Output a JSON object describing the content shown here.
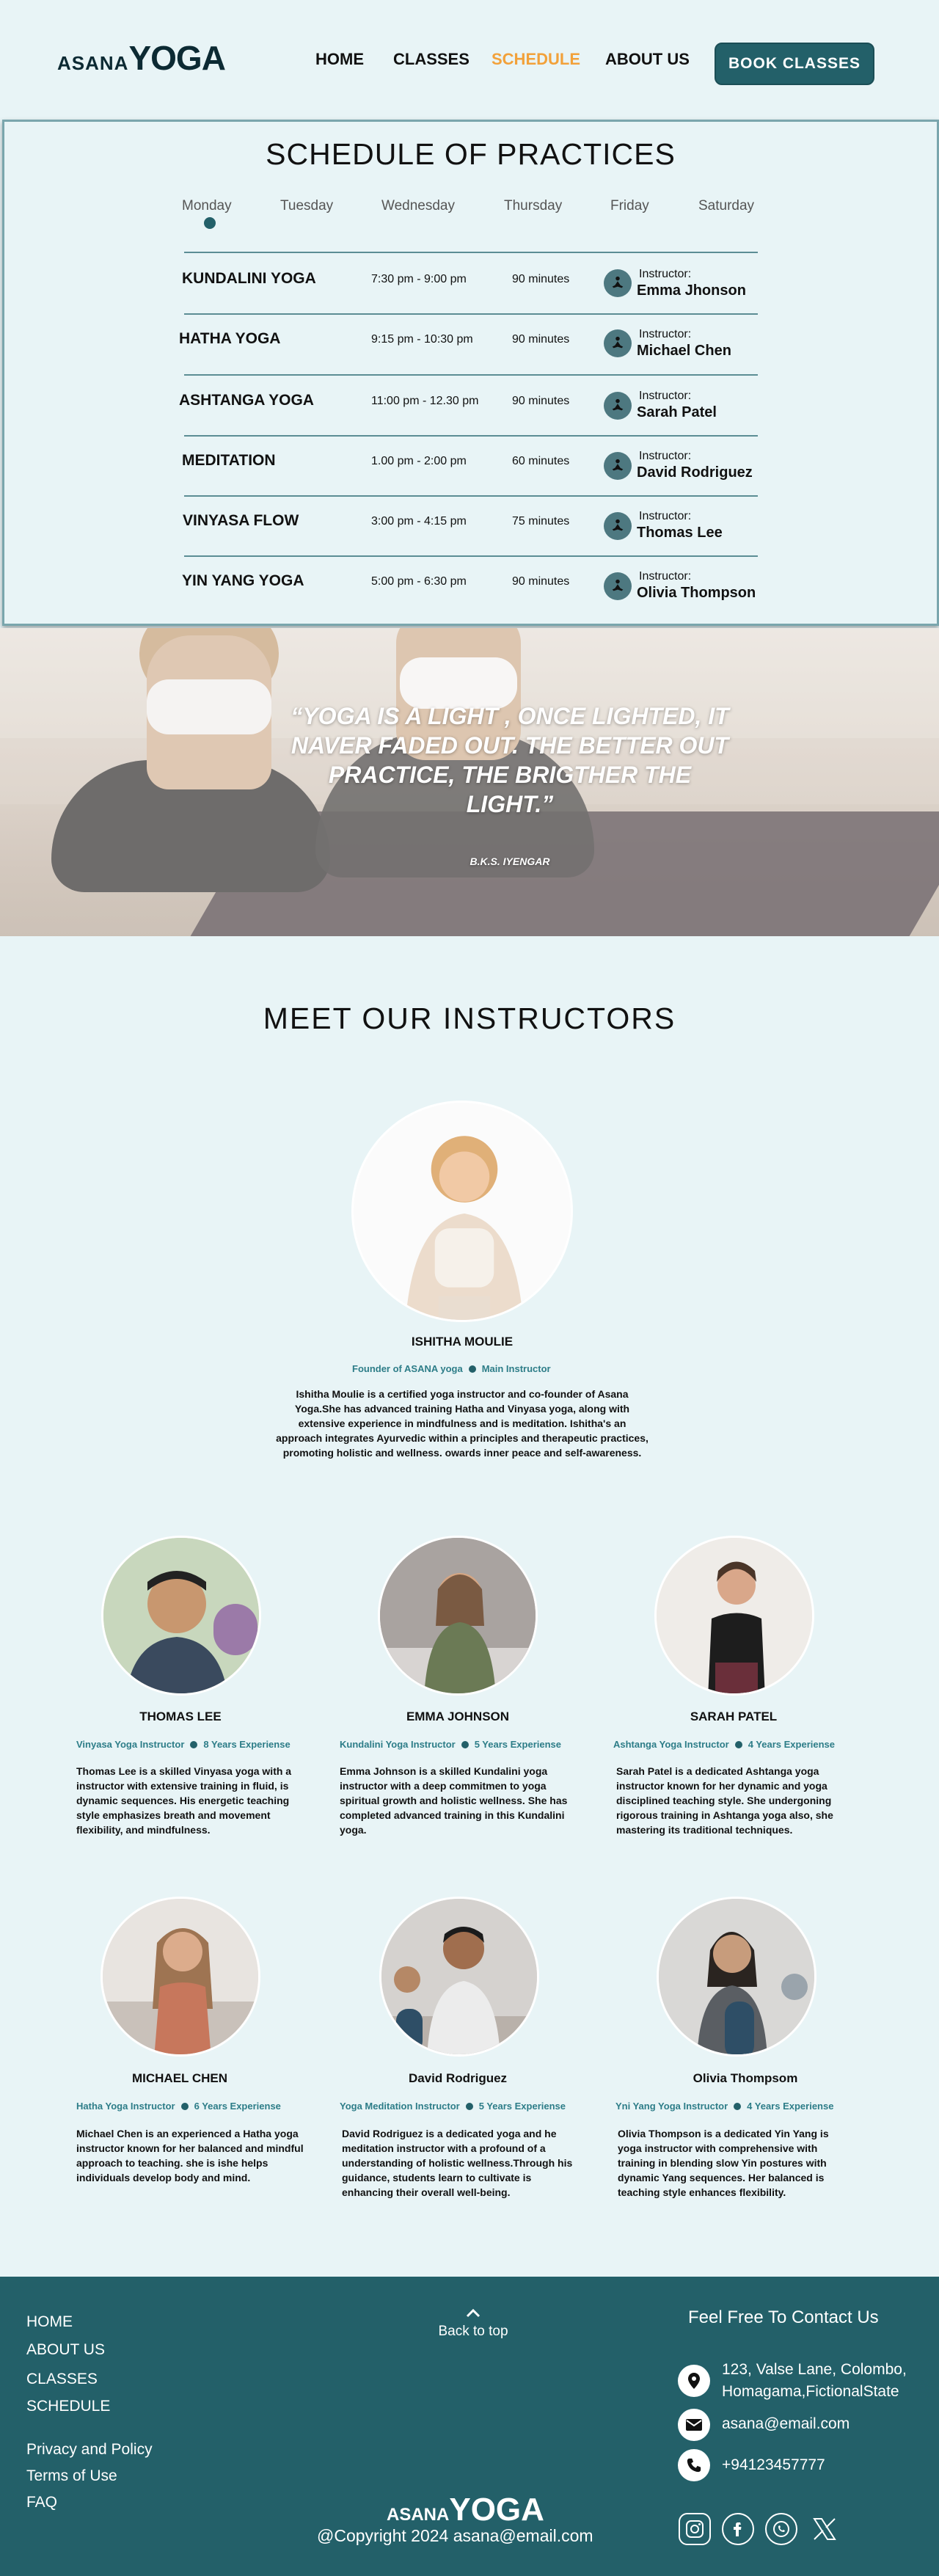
{
  "header": {
    "logo_small": "ASANA",
    "logo_big": "YOGA",
    "nav": [
      {
        "label": "HOME"
      },
      {
        "label": "CLASSES"
      },
      {
        "label": "SCHEDULE"
      },
      {
        "label": "ABOUT US"
      }
    ],
    "active_nav": "SCHEDULE",
    "book_label": "BOOK  CLASSES",
    "accent_color": "#f2a13a",
    "brand_color": "#236069"
  },
  "schedule": {
    "title": "SCHEDULE OF PRACTICES",
    "days": [
      "Monday",
      "Tuesday",
      "Wednesday",
      "Thursday",
      "Friday",
      "Saturday"
    ],
    "selected_day": "Monday",
    "instructor_label": "Instructor:",
    "rows": [
      {
        "name": "KUNDALINI YOGA",
        "time": "7:30 pm - 9:00 pm",
        "duration": "90 minutes",
        "instructor": "Emma Jhonson"
      },
      {
        "name": "HATHA YOGA",
        "time": "9:15 pm - 10:30 pm",
        "duration": "90 minutes",
        "instructor": "Michael  Chen"
      },
      {
        "name": "ASHTANGA YOGA",
        "time": "11:00 pm - 12.30 pm",
        "duration": "90 minutes",
        "instructor": "Sarah  Patel"
      },
      {
        "name": "MEDITATION",
        "time": "1.00 pm - 2:00 pm",
        "duration": "60 minutes",
        "instructor": "David Rodriguez"
      },
      {
        "name": "VINYASA FLOW",
        "time": "3:00 pm - 4:15 pm",
        "duration": "75 minutes",
        "instructor": "Thomas Lee"
      },
      {
        "name": "YIN YANG YOGA",
        "time": "5:00 pm - 6:30 pm",
        "duration": "90 minutes",
        "instructor": "Olivia Thompson"
      }
    ]
  },
  "hero": {
    "quote": "“YOGA IS A LIGHT , ONCE LIGHTED, IT NAVER FADED OUT. THE BETTER OUT PRACTICE,  THE BRIGTHER THE LIGHT.”",
    "author": "B.K.S. IYENGAR"
  },
  "instructors": {
    "title": "MEET OUR INSTRUCTORS",
    "founder": {
      "name": "ISHITHA MOULIE",
      "role": "Founder of ASANA yoga",
      "role2": "Main Instructor",
      "bio": "Ishitha Moulie is a certified yoga instructor and co-founder of Asana Yoga.She has advanced training  Hatha and Vinyasa yoga, along with extensive experience in mindfulness and is meditation. Ishitha's an approach integrates Ayurvedic within a principles and therapeutic practices, promoting holistic and wellness. owards inner peace and self-awareness."
    },
    "list": [
      {
        "name": "THOMAS LEE",
        "role": "Vinyasa Yoga Instructor",
        "exp": "8 Years Experiense",
        "bio": "Thomas Lee is a skilled Vinyasa yoga with a instructor with extensive training in fluid,  is dynamic sequences. His energetic teaching style emphasizes breath and movement flexibility, and mindfulness."
      },
      {
        "name": "EMMA JOHNSON",
        "role": "Kundalini Yoga Instructor",
        "exp": "5 Years Experiense",
        "bio": "Emma Johnson is a skilled Kundalini yoga instructor with a deep commitmen to yoga spiritual growth and holistic wellness. She has completed advanced training in this Kundalini yoga."
      },
      {
        "name": "SARAH PATEL",
        "role": "Ashtanga Yoga Instructor",
        "exp": "4 Years Experiense",
        "bio": "Sarah Patel is a  dedicated Ashtanga yoga instructor known for her dynamic and  yoga disciplined teaching style. She undergoning rigorous training in Ashtanga yoga also, she mastering its traditional  techniques."
      },
      {
        "name": "MICHAEL CHEN",
        "role": "Hatha  Yoga Instructor",
        "exp": "6 Years Experiense",
        "bio": "Michael Chen is an experienced a Hatha yoga instructor known for her balanced and mindful approach to teaching. she is ishe helps individuals develop body and mind."
      },
      {
        "name": "David  Rodriguez",
        "role": "Yoga Meditation  Instructor",
        "exp": "5 Years Experiense",
        "bio": "David Rodriguez is a dedicated yoga and he meditation instructor with a profound of a understanding of holistic wellness.Through his guidance, students learn to cultivate  is enhancing their overall well-being."
      },
      {
        "name": "Olivia Thompsom",
        "role": "Yni Yang Yoga Instructor",
        "exp": "4 Years Experiense",
        "bio": "Olivia Thompson is a dedicated Yin Yang  is yoga instructor with comprehensive  with training in blending slow Yin postures with dynamic Yang sequences. Her balanced is teaching style enhances flexibility."
      }
    ]
  },
  "footer": {
    "links1": [
      "HOME",
      "ABOUT US",
      "CLASSES",
      "SCHEDULE"
    ],
    "links2": [
      "Privacy and Policy",
      "Terms of Use",
      "FAQ"
    ],
    "back_to_top": "Back to top",
    "contact_title": "Feel Free To Contact Us",
    "address_line1": "123, Valse Lane, Colombo,",
    "address_line2": "Homagama,FictionalState",
    "email": "asana@email.com",
    "phone": "+94123457777",
    "logo_small": "ASANA",
    "logo_big": "YOGA",
    "copyright": "@Copyright  2024 asana@email.com",
    "social_icons": [
      "instagram-icon",
      "facebook-icon",
      "whatsapp-icon",
      "x-icon"
    ]
  }
}
